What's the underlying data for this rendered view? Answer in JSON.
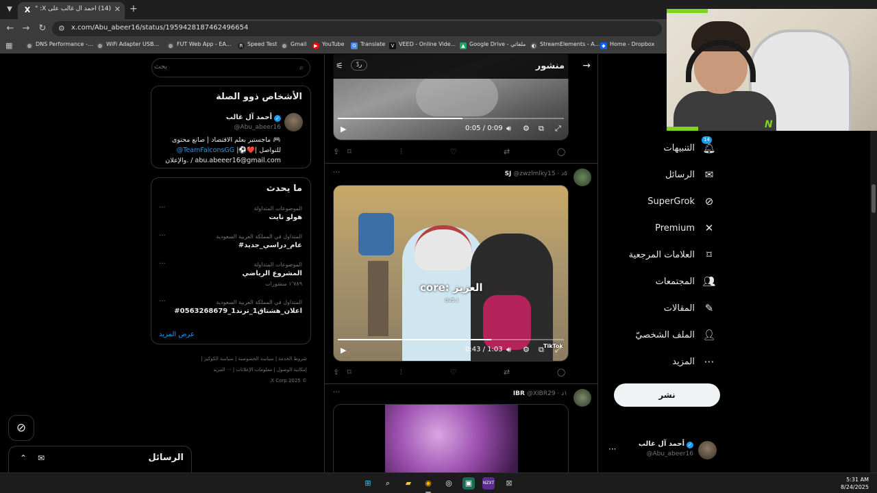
{
  "browser": {
    "tab_title": "(14) أحمد آل غالب على X: \"الميزة",
    "tab_favicon": "X",
    "url": "x.com/Abu_abeer16/status/1959428187462496654",
    "bookmarks": [
      {
        "label": "DNS Performance -...",
        "icon": "globe-icon",
        "color": "#4a4a4a"
      },
      {
        "label": "WiFi Adapter USB...",
        "icon": "globe-icon",
        "color": "#4a4a4a"
      },
      {
        "label": "FUT Web App - EA...",
        "icon": "globe-icon",
        "color": "#4a4a4a"
      },
      {
        "label": "Speed Test",
        "icon": "r-icon",
        "color": "#222222"
      },
      {
        "label": "Gmail",
        "icon": "gmail-icon",
        "color": "#4a4a4a"
      },
      {
        "label": "YouTube",
        "icon": "youtube-icon",
        "color": "#ff0000"
      },
      {
        "label": "Translate",
        "icon": "translate-icon",
        "color": "#4285f4"
      },
      {
        "label": "VEED - Online Vide...",
        "icon": "veed-icon",
        "color": "#111111"
      },
      {
        "label": "Google Drive - ملفاتي",
        "icon": "drive-icon",
        "color": "#1fa463"
      },
      {
        "label": "StreamElements - A...",
        "icon": "streamelements-icon",
        "color": "#555555"
      },
      {
        "label": "Home - Dropbox",
        "icon": "dropbox-icon",
        "color": "#0061ff"
      }
    ]
  },
  "nav": {
    "notifications_badge": "14",
    "items": [
      {
        "key": "notifications",
        "label": "التنبيهات"
      },
      {
        "key": "messages",
        "label": "الرسائل"
      },
      {
        "key": "supergrok",
        "label": "SuperGrok"
      },
      {
        "key": "premium",
        "label": "Premium"
      },
      {
        "key": "bookmarks",
        "label": "العلامات المرجعية"
      },
      {
        "key": "communities",
        "label": "المجتمعات"
      },
      {
        "key": "articles",
        "label": "المقالات"
      },
      {
        "key": "profile",
        "label": "الملف الشخصيّ"
      },
      {
        "key": "more",
        "label": "المزيد"
      }
    ],
    "post_label": "نشر"
  },
  "account": {
    "name": "أحمد آل غالب",
    "handle": "@Abu_abeer16"
  },
  "timeline": {
    "header_title": "منشور",
    "reply_label": "ردّ",
    "posts": [
      {
        "video": {
          "current": "0:05",
          "duration": "0:09",
          "progress": 0.55
        }
      },
      {
        "author": "SJ",
        "handle": "@zwzlmlky15",
        "time": "٥د",
        "video": {
          "current": "0:43",
          "duration": "1:03",
          "progress": 0.68,
          "caption": "core: العزيز",
          "sub_caption": "dv5.l",
          "watermark": "TikTok"
        }
      },
      {
        "author": "IBR",
        "handle": "@XIBR29",
        "time": "١د"
      }
    ]
  },
  "sidebar": {
    "search_placeholder": "بحث",
    "related": {
      "title": "الأشخاص ذوو الصلة",
      "name": "أحمد آل غالب",
      "handle": "@Abu_abeer16",
      "bio_line1": "ماجستير بعلم الاقتصاد | صانع محتوى 🎮",
      "bio_line2_link": "@TeamFalconsGG",
      "bio_line2_rest": "|⚽❤️| للتواصل",
      "bio_line3": "والإعلان. / abu.abeeer16@gmail.com"
    },
    "trends": {
      "title": "ما يحدث",
      "items": [
        {
          "category": "الموضوعات المتداولة",
          "name": "هولو نايت",
          "count": ""
        },
        {
          "category": "المتداول في المملكة العربية السعودية",
          "name": "#عام_دراسي_جديد",
          "count": ""
        },
        {
          "category": "الموضوعات المتداولة",
          "name": "المشروع الرياضي",
          "count": "١٬٧٨٩ منشورات"
        },
        {
          "category": "المتداول في المملكة العربية السعودية",
          "name": "#اعلان_هشتاق1_ترند1_0563268679",
          "count": ""
        }
      ],
      "show_more": "عرض المزيد"
    },
    "footer": {
      "line1": "شروط الخدمة | سياسة الخصوصية | سياسة الكوكيز |",
      "line2": "إمكانية الوصول | معلومات الإعلانات | ··· المزيد",
      "line3": "© 2025 X Corp."
    }
  },
  "messages_drawer": {
    "title": "الرسائل"
  },
  "taskbar": {
    "time": "5:31 AM",
    "date": "8/24/2025"
  },
  "webcam": {
    "logo": "N"
  },
  "colors": {
    "accent": "#1d9bf0",
    "border": "#2f3336",
    "muted": "#71767b",
    "falcons_green": "#7ed321"
  }
}
